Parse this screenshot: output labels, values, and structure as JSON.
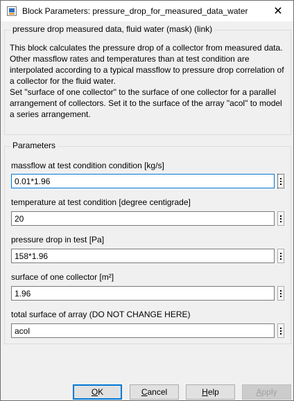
{
  "window": {
    "title": "Block Parameters: pressure_drop_for_measured_data_water",
    "close_glyph": "✕"
  },
  "description": {
    "group_title": "pressure drop measured data, fluid water (mask) (link)",
    "lines": [
      "This block calculates the pressure drop of a collector from measured data.",
      "Other massflow rates and temperatures than at test condition are interpolated according to a typical massflow to pressure drop correlation of a collector for the fluid water.",
      "Set \"surface of one collector\" to the surface of one collector for a parallel arrangement of collectors. Set it to the surface of the array \"acol\" to model a series arrangement."
    ]
  },
  "parameters": {
    "group_title": "Parameters",
    "items": [
      {
        "label": "massflow at test condition condition [kg/s]",
        "value": "0.01*1.96"
      },
      {
        "label": "temperature at test condition [degree centigrade]",
        "value": "20"
      },
      {
        "label": "pressure drop in test [Pa]",
        "value": "158*1.96"
      },
      {
        "label": "surface of one collector [m²]",
        "value": "1.96"
      },
      {
        "label": "total surface of array (DO NOT CHANGE HERE)",
        "value": "acol"
      }
    ]
  },
  "buttons": {
    "ok": {
      "first": "O",
      "rest": "K"
    },
    "cancel": {
      "first": "C",
      "rest": "ancel"
    },
    "help": {
      "first": "H",
      "rest": "elp"
    },
    "apply": {
      "first": "A",
      "rest": "pply"
    }
  },
  "icons": {
    "app": "simulink-block-icon",
    "close": "close-icon",
    "options": "kebab-menu-icon"
  },
  "colors": {
    "focus_accent": "#0078d7",
    "window_bg": "#f0f0f0"
  }
}
